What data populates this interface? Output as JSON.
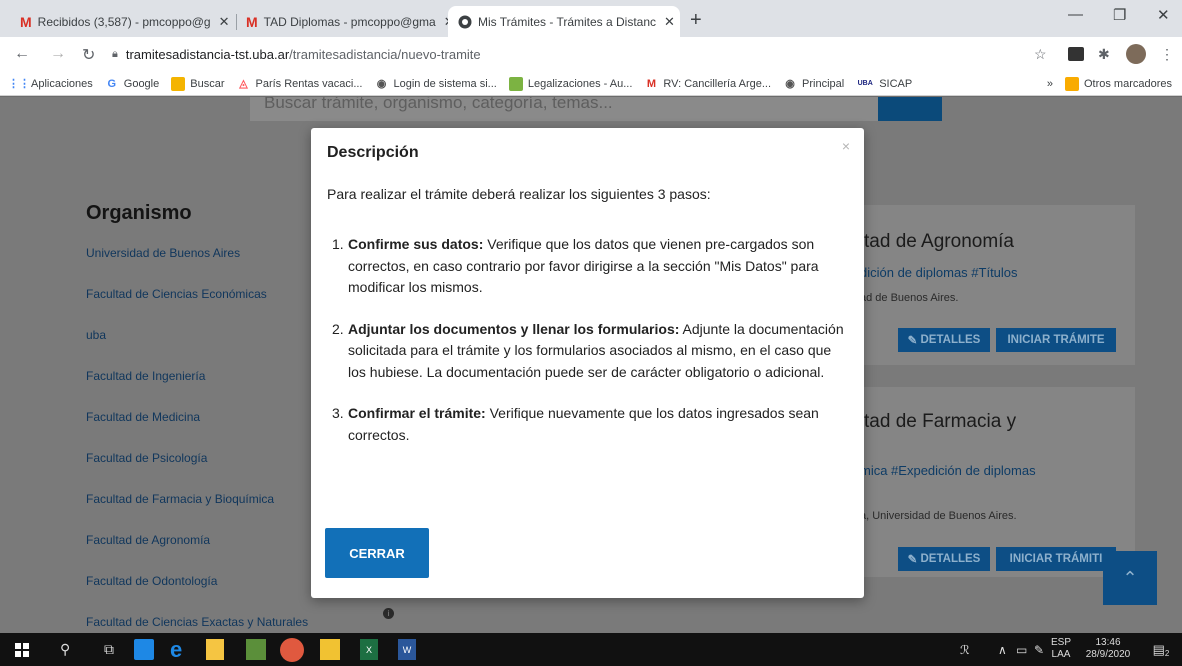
{
  "browser": {
    "tabs": [
      {
        "title": "Recibidos (3,587) - pmcoppo@g",
        "icon": "gmail-icon"
      },
      {
        "title": "TAD Diplomas - pmcoppo@gma",
        "icon": "gmail-icon"
      },
      {
        "title": "Mis Trámites - Trámites a Distanc",
        "icon": "site-icon"
      }
    ],
    "tab_close": "✕",
    "new_tab": "+",
    "address": {
      "host": "tramitesadistancia-tst.uba.ar",
      "path": "/tramitesadistancia/nuevo-tramite"
    },
    "bookmarks": [
      {
        "label": "Aplicaciones",
        "icon": "apps-icon"
      },
      {
        "label": "Google",
        "icon": "google-icon"
      },
      {
        "label": "Buscar",
        "icon": "buscar-icon"
      },
      {
        "label": "París Rentas vacaci...",
        "icon": "airbnb-icon"
      },
      {
        "label": "Login de sistema si...",
        "icon": "globe-icon"
      },
      {
        "label": "Legalizaciones - Au...",
        "icon": "legalizaciones-icon"
      },
      {
        "label": "RV: Cancillería Arge...",
        "icon": "gmail-icon"
      },
      {
        "label": "Principal",
        "icon": "globe-icon"
      },
      {
        "label": "SICAP",
        "icon": "uba-icon"
      }
    ],
    "bookmarks_overflow": "»",
    "other_bookmarks": "Otros marcadores"
  },
  "page": {
    "search_placeholder": "Buscar trámite, organismo, categoría, temas...",
    "organismo": {
      "title": "Organismo",
      "items": [
        "Universidad de Buenos Aires",
        "Facultad de Ciencias Económicas",
        "uba",
        "Facultad de Ingeniería",
        "Facultad de Medicina",
        "Facultad de Psicología",
        "Facultad de Farmacia y Bioquímica",
        "Facultad de Agronomía",
        "Facultad de Odontología",
        "Facultad de Ciencias Exactas y Naturales"
      ]
    },
    "cards": [
      {
        "title": "tad de Agronomía",
        "tags": "dición de diplomas #Títulos",
        "subtitle": "ad de Buenos Aires.",
        "details": "DETALLES",
        "start": "INICIAR TRÁMITE"
      },
      {
        "title": "tad de Farmacia y",
        "tags": "mica #Expedición de diplomas",
        "subtitle": "a, Universidad de Buenos Aires.",
        "details": "DETALLES",
        "start": "INICIAR TRÁMITI"
      }
    ]
  },
  "modal": {
    "title": "Descripción",
    "close": "×",
    "intro": "Para realizar el trámite deberá realizar los siguientes 3 pasos:",
    "steps": [
      {
        "num": "1.",
        "bold": "Confirme sus datos:",
        "text": " Verifique que los datos que vienen pre-cargados son correctos, en caso contrario por favor dirigirse a la sección \"Mis Datos\" para modificar los mismos."
      },
      {
        "num": "2.",
        "bold": "Adjuntar los documentos y llenar los formularios:",
        "text": " Adjunte la documentación solicitada para el trámite y los formularios asociados al mismo, en el caso que los hubiese. La documentación puede ser de carácter obligatorio o adicional."
      },
      {
        "num": "3.",
        "bold": "Confirmar el trámite:",
        "text": " Verifique nuevamente que los datos ingresados sean correctos."
      }
    ],
    "button": "CERRAR"
  },
  "taskbar": {
    "lang_top": "ESP",
    "lang_bottom": "LAA",
    "time": "13:46",
    "date": "28/9/2020",
    "notif_count": "2"
  }
}
